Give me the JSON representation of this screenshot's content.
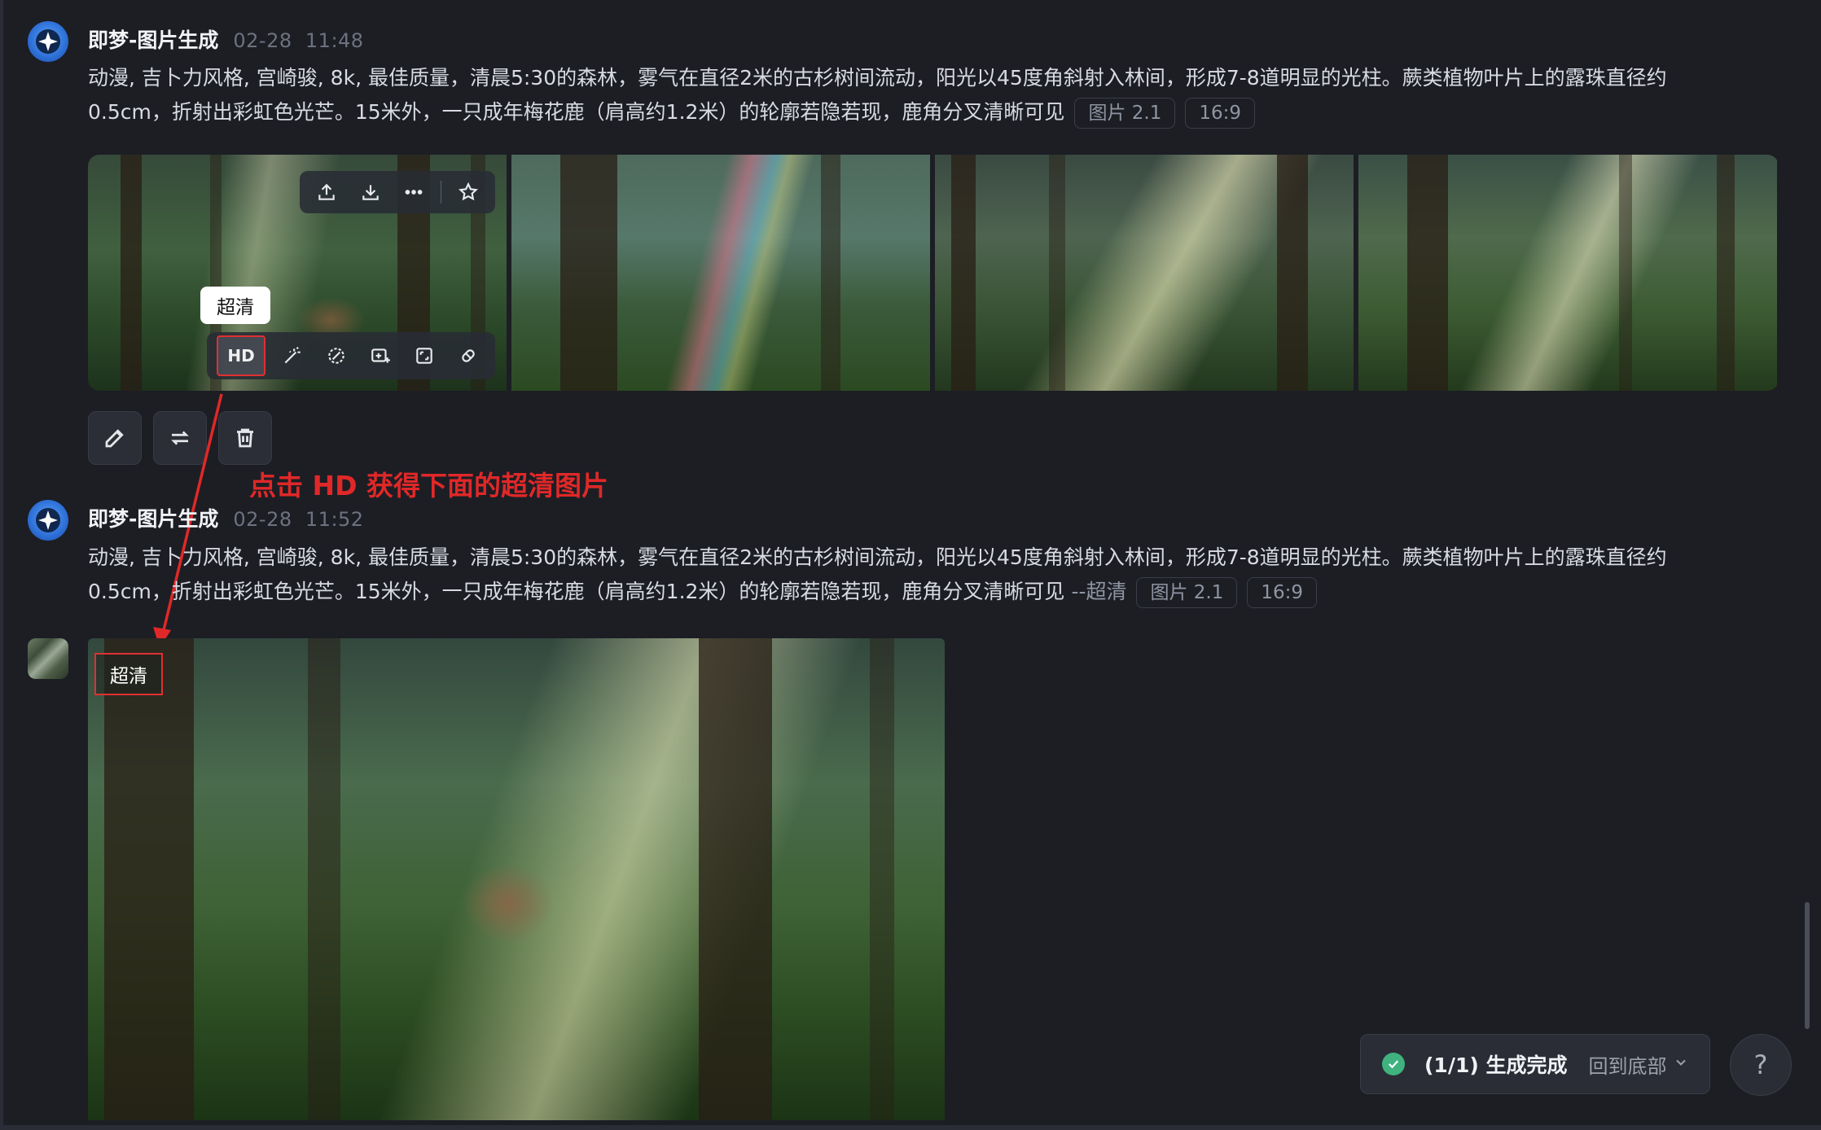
{
  "messages": [
    {
      "name": "即梦-图片生成",
      "date": "02-28",
      "time": "11:48",
      "prompt": "动漫, 吉卜力风格, 宫崎骏, 8k, 最佳质量，清晨5:30的森林，雾气在直径2米的古杉树间流动，阳光以45度角斜射入林间，形成7-8道明显的光柱。蕨类植物叶片上的露珠直径约0.5cm，折射出彩虹色光芒。15米外，一只成年梅花鹿（肩高约1.2米）的轮廓若隐若现，鹿角分叉清晰可见",
      "model_chip": "图片 2.1",
      "ratio_chip": "16:9"
    },
    {
      "name": "即梦-图片生成",
      "date": "02-28",
      "time": "11:52",
      "prompt": "动漫, 吉卜力风格, 宫崎骏, 8k, 最佳质量，清晨5:30的森林，雾气在直径2米的古杉树间流动，阳光以45度角斜射入林间，形成7-8道明显的光柱。蕨类植物叶片上的露珠直径约0.5cm，折射出彩虹色光芒。15米外，一只成年梅花鹿（肩高约1.2米）的轮廓若隐若现，鹿角分叉清晰可见",
      "suffix": "--超清",
      "model_chip": "图片 2.1",
      "ratio_chip": "16:9"
    }
  ],
  "tooltip": "超清",
  "hd_button": "HD",
  "annotation": "点击 HD 获得下面的超清图片",
  "hd_label": "超清",
  "status": {
    "text": "(1/1) 生成完成",
    "link": "回到底部"
  },
  "help": "?",
  "icons": {
    "top_toolbar": [
      "share-icon",
      "download-icon",
      "more-icon",
      "star-icon"
    ],
    "bottom_toolbar": [
      "hd-upscale",
      "magic-wand-icon",
      "repaint-icon",
      "extend-image-icon",
      "crop-expand-icon",
      "eraser-icon"
    ],
    "actions": [
      "edit-icon",
      "regenerate-icon",
      "delete-icon"
    ]
  },
  "colors": {
    "background": "#1c1e24",
    "annotation": "#e02828",
    "success": "#3fb27f"
  }
}
